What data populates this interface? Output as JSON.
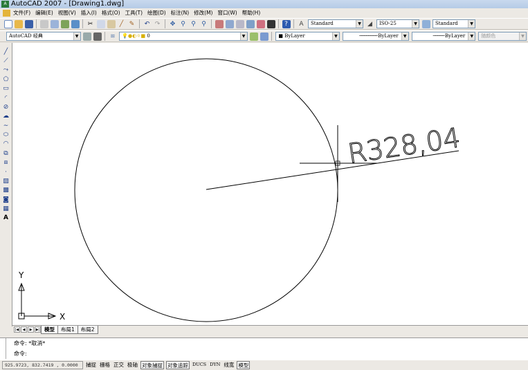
{
  "window": {
    "title": "AutoCAD 2007 - [Drawing1.dwg]",
    "app_icon": "autocad-logo"
  },
  "menu": [
    "文件(F)",
    "编辑(E)",
    "视图(V)",
    "插入(I)",
    "格式(O)",
    "工具(T)",
    "绘图(D)",
    "标注(N)",
    "修改(M)",
    "窗口(W)",
    "帮助(H)"
  ],
  "toolbar": {
    "text_style": "Standard",
    "dim_style": "ISO-25",
    "table_style": "Standard",
    "workspace": "AutoCAD 经典",
    "layer": "0",
    "color": "ByLayer",
    "linetype": "ByLayer",
    "lineweight": "ByLayer",
    "plot_style": "随颜色"
  },
  "drawing": {
    "dimension_text": "R328,04",
    "ucs_x": "X",
    "ucs_y": "Y",
    "accent_color": "#000000"
  },
  "tabs": [
    "模型",
    "布局1",
    "布局2"
  ],
  "command": {
    "line1": "命令: *取消*",
    "line2": "命令:"
  },
  "status": {
    "coords": "925.9723,  832.7419 , 0.0000",
    "buttons": [
      {
        "label": "捕捉",
        "on": false
      },
      {
        "label": "栅格",
        "on": false
      },
      {
        "label": "正交",
        "on": false
      },
      {
        "label": "极轴",
        "on": false
      },
      {
        "label": "对象捕捉",
        "on": true
      },
      {
        "label": "对象追踪",
        "on": true
      },
      {
        "label": "DUCS",
        "on": false
      },
      {
        "label": "DYN",
        "on": false
      },
      {
        "label": "线宽",
        "on": false
      },
      {
        "label": "模型",
        "on": true
      }
    ]
  }
}
